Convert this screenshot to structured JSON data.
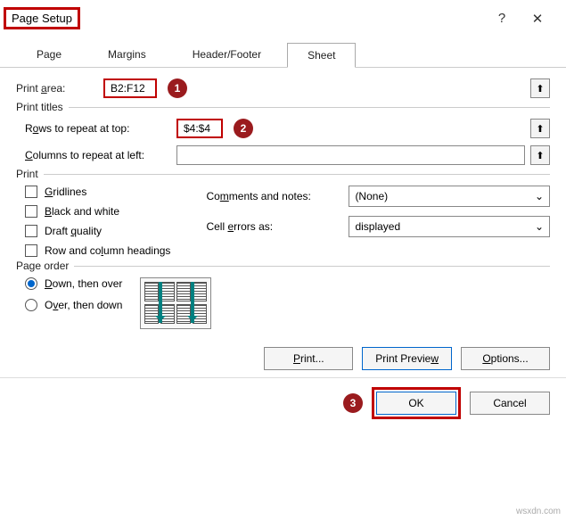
{
  "title": "Page Setup",
  "help_glyph": "?",
  "close_glyph": "✕",
  "tabs": [
    "Page",
    "Margins",
    "Header/Footer",
    "Sheet"
  ],
  "active_tab": "Sheet",
  "print_area_label": "Print area:",
  "print_area_value": "B2:F12",
  "badges": {
    "one": "1",
    "two": "2",
    "three": "3"
  },
  "ref_glyph": "⬆",
  "titles": {
    "group": "Print titles",
    "rows_label_pre": "R",
    "rows_label_u": "o",
    "rows_label_post": "ws to repeat at top:",
    "rows_value": "$4:$4",
    "cols_label_pre": "",
    "cols_label_u": "C",
    "cols_label_post": "olumns to repeat at left:",
    "cols_value": ""
  },
  "print": {
    "group": "Print",
    "gridlines_pre": "",
    "gridlines_u": "G",
    "gridlines_post": "ridlines",
    "bw_pre": "",
    "bw_u": "B",
    "bw_post": "lack and white",
    "draft_pre": "Draft ",
    "draft_u": "q",
    "draft_post": "uality",
    "rowcol_pre": "Row and co",
    "rowcol_u": "l",
    "rowcol_post": "umn headings",
    "comments_label_pre": "Co",
    "comments_label_u": "m",
    "comments_label_post": "ments and notes:",
    "comments_value": "(None)",
    "errors_label_pre": "Cell ",
    "errors_label_u": "e",
    "errors_label_post": "rrors as:",
    "errors_value": "displayed",
    "chevron": "⌄"
  },
  "order": {
    "group": "Page order",
    "down_pre": "",
    "down_u": "D",
    "down_post": "own, then over",
    "over_pre": "O",
    "over_u": "v",
    "over_post": "er, then down"
  },
  "buttons": {
    "print_pre": "",
    "print_u": "P",
    "print_post": "rint...",
    "preview_pre": "Print Previe",
    "preview_u": "w",
    "preview_post": "",
    "options_pre": "",
    "options_u": "O",
    "options_post": "ptions...",
    "ok": "OK",
    "cancel": "Cancel"
  },
  "watermark": "wsxdn.com"
}
